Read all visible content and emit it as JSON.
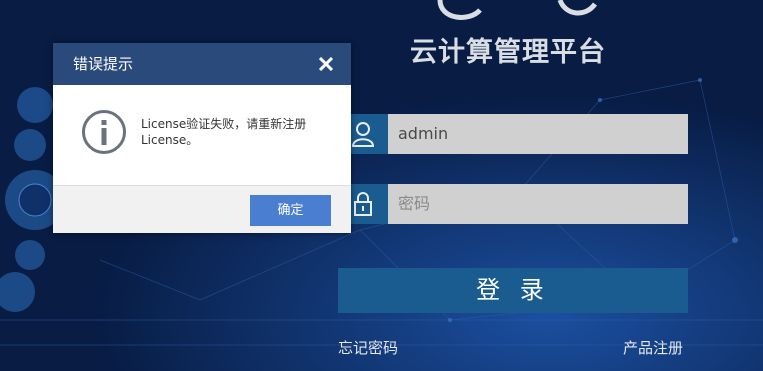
{
  "brand": {
    "title": "云计算管理平台"
  },
  "login": {
    "username_value": "admin",
    "password_placeholder": "密码",
    "submit_label": "登 录",
    "forgot_password_label": "忘记密码",
    "register_label": "产品注册"
  },
  "dialog": {
    "title": "错误提示",
    "message": "License验证失败，请重新注册License。",
    "ok_label": "确定"
  },
  "colors": {
    "background": "#0a2452",
    "dialog_header": "#2a4a7c",
    "login_button": "#1a5c8f",
    "ok_button": "#4a7ed0",
    "input_fill": "#d0d0d0"
  }
}
